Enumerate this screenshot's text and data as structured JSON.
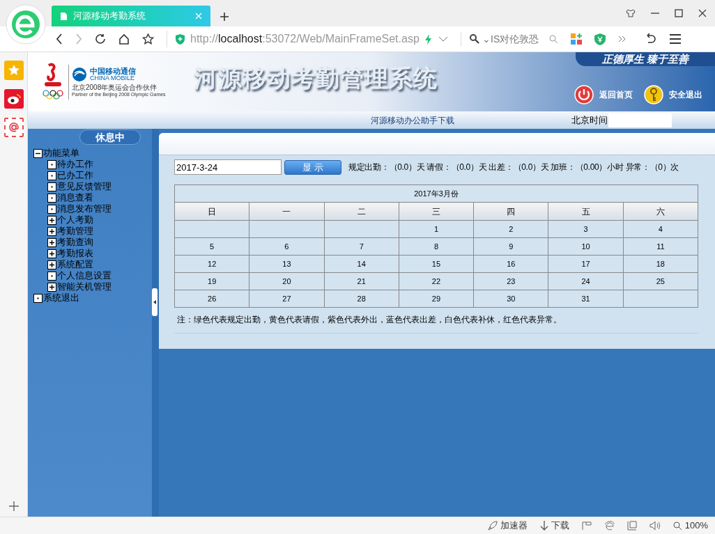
{
  "browser": {
    "tab_title": "河源移动考勤系统",
    "url_scheme": "http://",
    "url_host": "localhost",
    "url_path": ":53072/Web/MainFrameSet.asp",
    "search_text": "⌄IS对伦敦恐"
  },
  "header": {
    "logo_cn": "中国移动通信",
    "logo_en": "CHINA MOBILE",
    "logo_partner_cn": "北京2008年奥运会合作伙伴",
    "logo_partner_en": "Partner of the Beijing 2008 Olympic Games",
    "title": "河源移动考勤管理系统",
    "slogan": "正德厚生 臻于至善",
    "buttons": [
      "返回首页",
      "安全退出"
    ]
  },
  "subbar": {
    "download_link": "河源移动办公助手下载",
    "time_label": "北京时间"
  },
  "menu": {
    "status": "休息中",
    "tree": [
      {
        "label": "功能菜单",
        "kind": "expanded",
        "children": [
          {
            "label": "待办工作",
            "kind": "leaf"
          },
          {
            "label": "已办工作",
            "kind": "leaf"
          },
          {
            "label": "意见反馈管理",
            "kind": "leaf"
          },
          {
            "label": "消息查看",
            "kind": "leaf"
          },
          {
            "label": "消息发布管理",
            "kind": "leaf"
          },
          {
            "label": "个人考勤",
            "kind": "collapsed"
          },
          {
            "label": "考勤管理",
            "kind": "collapsed"
          },
          {
            "label": "考勤查询",
            "kind": "collapsed"
          },
          {
            "label": "考勤报表",
            "kind": "collapsed"
          },
          {
            "label": "系统配置",
            "kind": "collapsed"
          },
          {
            "label": "个人信息设置",
            "kind": "leaf"
          },
          {
            "label": "智能关机管理",
            "kind": "collapsed"
          }
        ]
      },
      {
        "label": "系统退出",
        "kind": "leaf"
      }
    ]
  },
  "query": {
    "date_value": "2017-3-24",
    "show_button": "显 示",
    "summary": "规定出勤：（0.0）天 请假：（0.0）天 出差：（0.0）天 加班：（0.00）小时 异常：（0）次"
  },
  "calendar": {
    "title": "2017年3月份",
    "weekdays": [
      "日",
      "一",
      "二",
      "三",
      "四",
      "五",
      "六"
    ],
    "weeks": [
      [
        "1",
        "2",
        "3",
        "4"
      ],
      [
        "5",
        "6",
        "7",
        "8",
        "9",
        "10",
        "11"
      ],
      [
        "12",
        "13",
        "14",
        "15",
        "16",
        "17",
        "18"
      ],
      [
        "19",
        "20",
        "21",
        "22",
        "23",
        "24",
        "25"
      ],
      [
        "26",
        "27",
        "28",
        "29",
        "30",
        "31"
      ]
    ]
  },
  "note": "注：绿色代表规定出勤，黄色代表请假，紫色代表外出，蓝色代表出差，白色代表补休，红色代表异常。",
  "status_bar": {
    "items": [
      "加速器",
      "下载"
    ],
    "zoom": "100%"
  }
}
